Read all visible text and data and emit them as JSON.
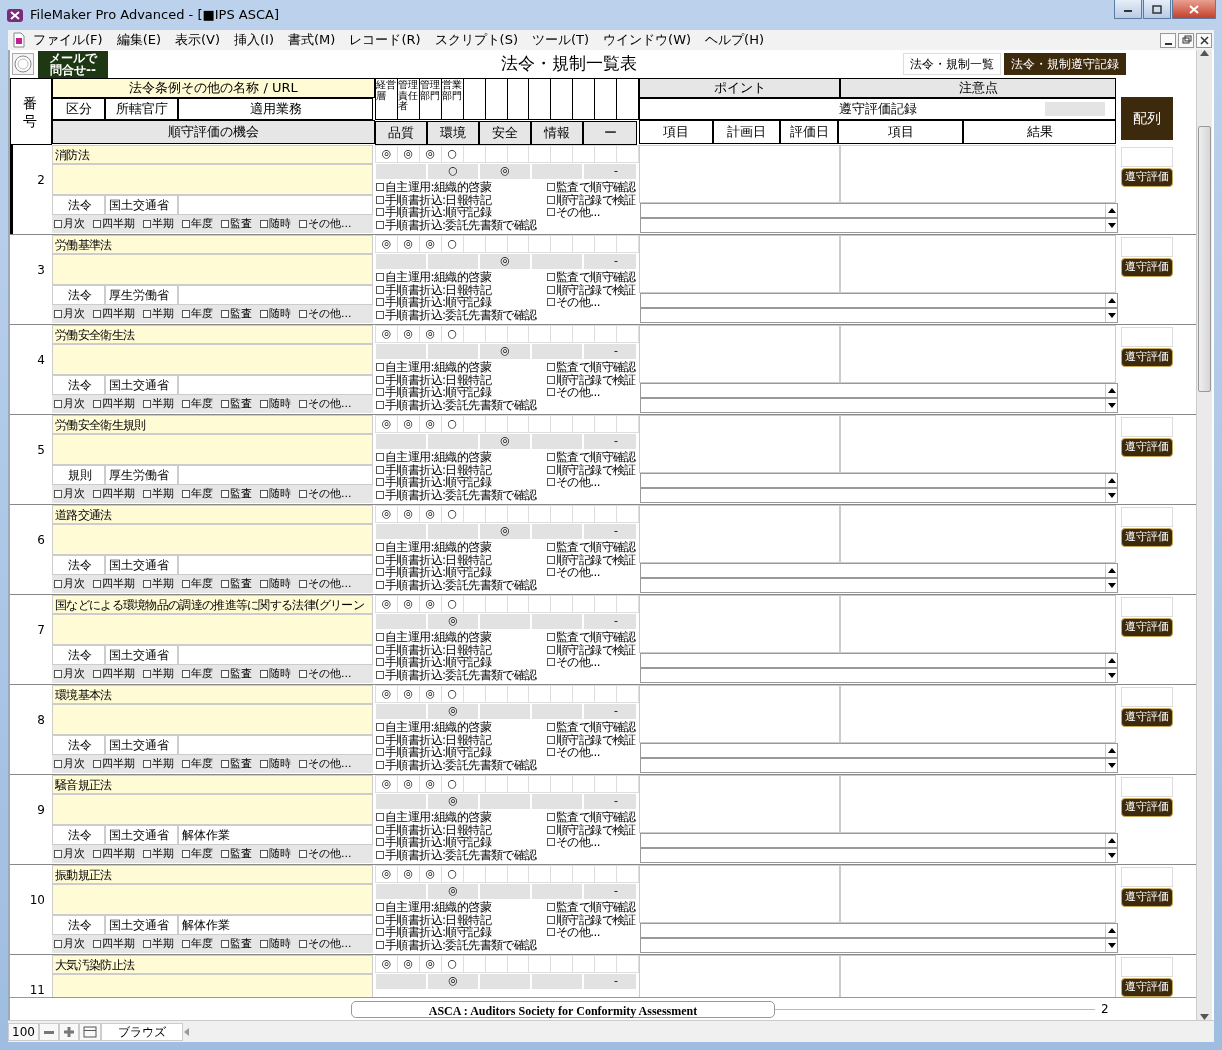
{
  "window": {
    "title": "FileMaker Pro Advanced - [■IPS ASCA]"
  },
  "menu": [
    "ファイル(F)",
    "編集(E)",
    "表示(V)",
    "挿入(I)",
    "書式(M)",
    "レコード(R)",
    "スクリプト(S)",
    "ツール(T)",
    "ウインドウ(W)",
    "ヘルプ(H)"
  ],
  "top": {
    "mail_button": [
      "メールで",
      "問合せ--"
    ],
    "title": "法令・規制一覧表"
  },
  "tabs": [
    {
      "label": "法令・規制一覧",
      "selected": false
    },
    {
      "label": "法令・規制遵守記録",
      "selected": true
    }
  ],
  "header": {
    "number": "番号",
    "name_url": "法令条例その他の名称 / URL",
    "kubun": "区分",
    "agency": "所轄官庁",
    "business": "適用業務",
    "opportunity": "順守評価の機会",
    "departments": [
      "経営層",
      "管理責任者",
      "管理部門",
      "営業部門"
    ],
    "categories": [
      "品質",
      "環境",
      "安全",
      "情報",
      "ー"
    ],
    "point": "ポイント",
    "caution": "注意点",
    "record_title": "遵守評価記録",
    "record_columns": [
      "項目",
      "計画日",
      "評価日",
      "項目",
      "結果"
    ],
    "sort_button": "配列"
  },
  "records": [
    {
      "number": "2",
      "selected": true,
      "name": "消防法",
      "kubun": "法令",
      "agency": "国土交通省",
      "department_marks": [
        "◎",
        "◎",
        "◎",
        "○"
      ],
      "category_marks": {
        "environment": "○",
        "safety": "◎",
        "other": "-"
      },
      "period_checks": [
        {
          "label": "月次",
          "checked": false
        },
        {
          "label": "四半期",
          "checked": false
        },
        {
          "label": "半期",
          "checked": false
        },
        {
          "label": "年度",
          "checked": false
        },
        {
          "label": "監査",
          "checked": false
        },
        {
          "label": "随時",
          "checked": false
        },
        {
          "label": "その他...",
          "checked": false
        }
      ],
      "method_checks": [
        {
          "label": "自主運用:組織的啓蒙",
          "checked": false
        },
        {
          "label": "手順書折込:日報特記",
          "checked": false
        },
        {
          "label": "手順書折込:順守記録",
          "checked": false
        },
        {
          "label": "手順書折込:委託先書類で確認",
          "checked": false
        },
        {
          "label": "監査で順守確認",
          "checked": false
        },
        {
          "label": "順守記録で検証",
          "checked": false
        },
        {
          "label": "その他...",
          "checked": false
        }
      ],
      "button": "遵守評価"
    },
    {
      "number": "3",
      "selected": false,
      "name": "労働基準法",
      "kubun": "法令",
      "agency": "厚生労働省",
      "department_marks": [
        "◎",
        "◎",
        "◎",
        "○"
      ],
      "category_marks": {
        "safety": "◎",
        "other": "-"
      },
      "period_checks": [
        {
          "label": "月次",
          "checked": false
        },
        {
          "label": "四半期",
          "checked": false
        },
        {
          "label": "半期",
          "checked": false
        },
        {
          "label": "年度",
          "checked": false
        },
        {
          "label": "監査",
          "checked": false
        },
        {
          "label": "随時",
          "checked": false
        },
        {
          "label": "その他...",
          "checked": false
        }
      ],
      "method_checks": [
        {
          "label": "自主運用:組織的啓蒙",
          "checked": false
        },
        {
          "label": "手順書折込:日報特記",
          "checked": false
        },
        {
          "label": "手順書折込:順守記録",
          "checked": false
        },
        {
          "label": "手順書折込:委託先書類で確認",
          "checked": false
        },
        {
          "label": "監査で順守確認",
          "checked": false
        },
        {
          "label": "順守記録で検証",
          "checked": false
        },
        {
          "label": "その他...",
          "checked": false
        }
      ],
      "button": "遵守評価"
    },
    {
      "number": "4",
      "selected": false,
      "name": "労働安全衛生法",
      "kubun": "法令",
      "agency": "国土交通省",
      "department_marks": [
        "◎",
        "◎",
        "◎",
        "○"
      ],
      "category_marks": {
        "safety": "◎",
        "other": "-"
      },
      "period_checks": [
        {
          "label": "月次",
          "checked": false
        },
        {
          "label": "四半期",
          "checked": false
        },
        {
          "label": "半期",
          "checked": false
        },
        {
          "label": "年度",
          "checked": false
        },
        {
          "label": "監査",
          "checked": false
        },
        {
          "label": "随時",
          "checked": false
        },
        {
          "label": "その他...",
          "checked": false
        }
      ],
      "method_checks": [
        {
          "label": "自主運用:組織的啓蒙",
          "checked": false
        },
        {
          "label": "手順書折込:日報特記",
          "checked": false
        },
        {
          "label": "手順書折込:順守記録",
          "checked": false
        },
        {
          "label": "手順書折込:委託先書類で確認",
          "checked": false
        },
        {
          "label": "監査で順守確認",
          "checked": false
        },
        {
          "label": "順守記録で検証",
          "checked": false
        },
        {
          "label": "その他...",
          "checked": false
        }
      ],
      "button": "遵守評価"
    },
    {
      "number": "5",
      "selected": false,
      "name": "労働安全衛生規則",
      "kubun": "規則",
      "agency": "厚生労働省",
      "department_marks": [
        "◎",
        "◎",
        "◎",
        "○"
      ],
      "category_marks": {
        "safety": "◎",
        "other": "-"
      },
      "period_checks": [
        {
          "label": "月次",
          "checked": false
        },
        {
          "label": "四半期",
          "checked": false
        },
        {
          "label": "半期",
          "checked": false
        },
        {
          "label": "年度",
          "checked": false
        },
        {
          "label": "監査",
          "checked": false
        },
        {
          "label": "随時",
          "checked": false
        },
        {
          "label": "その他...",
          "checked": false
        }
      ],
      "method_checks": [
        {
          "label": "自主運用:組織的啓蒙",
          "checked": false
        },
        {
          "label": "手順書折込:日報特記",
          "checked": false
        },
        {
          "label": "手順書折込:順守記録",
          "checked": false
        },
        {
          "label": "手順書折込:委託先書類で確認",
          "checked": false
        },
        {
          "label": "監査で順守確認",
          "checked": false
        },
        {
          "label": "順守記録で検証",
          "checked": false
        },
        {
          "label": "その他...",
          "checked": false
        }
      ],
      "button": "遵守評価"
    },
    {
      "number": "6",
      "selected": false,
      "name": "道路交通法",
      "kubun": "法令",
      "agency": "国土交通省",
      "department_marks": [
        "◎",
        "◎",
        "◎",
        "○"
      ],
      "category_marks": {
        "safety": "◎",
        "other": "-"
      },
      "period_checks": [
        {
          "label": "月次",
          "checked": false
        },
        {
          "label": "四半期",
          "checked": false
        },
        {
          "label": "半期",
          "checked": false
        },
        {
          "label": "年度",
          "checked": false
        },
        {
          "label": "監査",
          "checked": false
        },
        {
          "label": "随時",
          "checked": false
        },
        {
          "label": "その他...",
          "checked": false
        }
      ],
      "method_checks": [
        {
          "label": "自主運用:組織的啓蒙",
          "checked": false
        },
        {
          "label": "手順書折込:日報特記",
          "checked": false
        },
        {
          "label": "手順書折込:順守記録",
          "checked": false
        },
        {
          "label": "手順書折込:委託先書類で確認",
          "checked": false
        },
        {
          "label": "監査で順守確認",
          "checked": false
        },
        {
          "label": "順守記録で検証",
          "checked": false
        },
        {
          "label": "その他...",
          "checked": false
        }
      ],
      "button": "遵守評価"
    },
    {
      "number": "7",
      "selected": false,
      "name": "国などによる環境物品の調達の推進等に関する法律(グリーン",
      "kubun": "法令",
      "agency": "国土交通省",
      "department_marks": [
        "◎",
        "◎",
        "◎",
        "○"
      ],
      "category_marks": {
        "environment": "◎",
        "other": "-"
      },
      "period_checks": [
        {
          "label": "月次",
          "checked": false
        },
        {
          "label": "四半期",
          "checked": false
        },
        {
          "label": "半期",
          "checked": false
        },
        {
          "label": "年度",
          "checked": false
        },
        {
          "label": "監査",
          "checked": false
        },
        {
          "label": "随時",
          "checked": false
        },
        {
          "label": "その他...",
          "checked": false
        }
      ],
      "method_checks": [
        {
          "label": "自主運用:組織的啓蒙",
          "checked": false
        },
        {
          "label": "手順書折込:日報特記",
          "checked": false
        },
        {
          "label": "手順書折込:順守記録",
          "checked": false
        },
        {
          "label": "手順書折込:委託先書類で確認",
          "checked": false
        },
        {
          "label": "監査で順守確認",
          "checked": false
        },
        {
          "label": "順守記録で検証",
          "checked": false
        },
        {
          "label": "その他...",
          "checked": false
        }
      ],
      "button": "遵守評価"
    },
    {
      "number": "8",
      "selected": false,
      "name": "環境基本法",
      "kubun": "法令",
      "agency": "国土交通省",
      "department_marks": [
        "◎",
        "◎",
        "◎",
        "○"
      ],
      "category_marks": {
        "environment": "◎",
        "other": "-"
      },
      "period_checks": [
        {
          "label": "月次",
          "checked": false
        },
        {
          "label": "四半期",
          "checked": false
        },
        {
          "label": "半期",
          "checked": false
        },
        {
          "label": "年度",
          "checked": false
        },
        {
          "label": "監査",
          "checked": false
        },
        {
          "label": "随時",
          "checked": false
        },
        {
          "label": "その他...",
          "checked": false
        }
      ],
      "method_checks": [
        {
          "label": "自主運用:組織的啓蒙",
          "checked": false
        },
        {
          "label": "手順書折込:日報特記",
          "checked": false
        },
        {
          "label": "手順書折込:順守記録",
          "checked": false
        },
        {
          "label": "手順書折込:委託先書類で確認",
          "checked": false
        },
        {
          "label": "監査で順守確認",
          "checked": false
        },
        {
          "label": "順守記録で検証",
          "checked": false
        },
        {
          "label": "その他...",
          "checked": false
        }
      ],
      "button": "遵守評価"
    },
    {
      "number": "9",
      "selected": false,
      "name": "騒音規正法",
      "kubun": "法令",
      "agency": "国土交通省",
      "business": "解体作業",
      "department_marks": [
        "◎",
        "◎",
        "◎",
        "○"
      ],
      "category_marks": {
        "environment": "◎",
        "other": "-"
      },
      "period_checks": [
        {
          "label": "月次",
          "checked": false
        },
        {
          "label": "四半期",
          "checked": false
        },
        {
          "label": "半期",
          "checked": false
        },
        {
          "label": "年度",
          "checked": false
        },
        {
          "label": "監査",
          "checked": false
        },
        {
          "label": "随時",
          "checked": false
        },
        {
          "label": "その他...",
          "checked": false
        }
      ],
      "method_checks": [
        {
          "label": "自主運用:組織的啓蒙",
          "checked": false
        },
        {
          "label": "手順書折込:日報特記",
          "checked": false
        },
        {
          "label": "手順書折込:順守記録",
          "checked": false
        },
        {
          "label": "手順書折込:委託先書類で確認",
          "checked": false
        },
        {
          "label": "監査で順守確認",
          "checked": false
        },
        {
          "label": "順守記録で検証",
          "checked": false
        },
        {
          "label": "その他...",
          "checked": false
        }
      ],
      "button": "遵守評価"
    },
    {
      "number": "10",
      "selected": false,
      "name": "振動規正法",
      "kubun": "法令",
      "agency": "国土交通省",
      "business": "解体作業",
      "department_marks": [
        "◎",
        "◎",
        "◎",
        "○"
      ],
      "category_marks": {
        "environment": "◎",
        "other": "-"
      },
      "period_checks": [
        {
          "label": "月次",
          "checked": false
        },
        {
          "label": "四半期",
          "checked": false
        },
        {
          "label": "半期",
          "checked": false
        },
        {
          "label": "年度",
          "checked": false
        },
        {
          "label": "監査",
          "checked": false
        },
        {
          "label": "随時",
          "checked": false
        },
        {
          "label": "その他...",
          "checked": false
        }
      ],
      "method_checks": [
        {
          "label": "自主運用:組織的啓蒙",
          "checked": false
        },
        {
          "label": "手順書折込:日報特記",
          "checked": false
        },
        {
          "label": "手順書折込:順守記録",
          "checked": false
        },
        {
          "label": "手順書折込:委託先書類で確認",
          "checked": false
        },
        {
          "label": "監査で順守確認",
          "checked": false
        },
        {
          "label": "順守記録で検証",
          "checked": false
        },
        {
          "label": "その他...",
          "checked": false
        }
      ],
      "button": "遵守評価"
    },
    {
      "number": "11",
      "selected": false,
      "name": "大気汚染防止法",
      "department_marks": [
        "◎",
        "◎",
        "◎",
        "○"
      ],
      "category_marks": {
        "environment": "◎",
        "other": "-"
      },
      "button": "遵守評価"
    }
  ],
  "footer": {
    "text": "ASCA : Auditors Society for Conformity Assessment",
    "page": "2"
  },
  "status_bar": {
    "zoom": "100",
    "mode": "ブラウズ"
  }
}
